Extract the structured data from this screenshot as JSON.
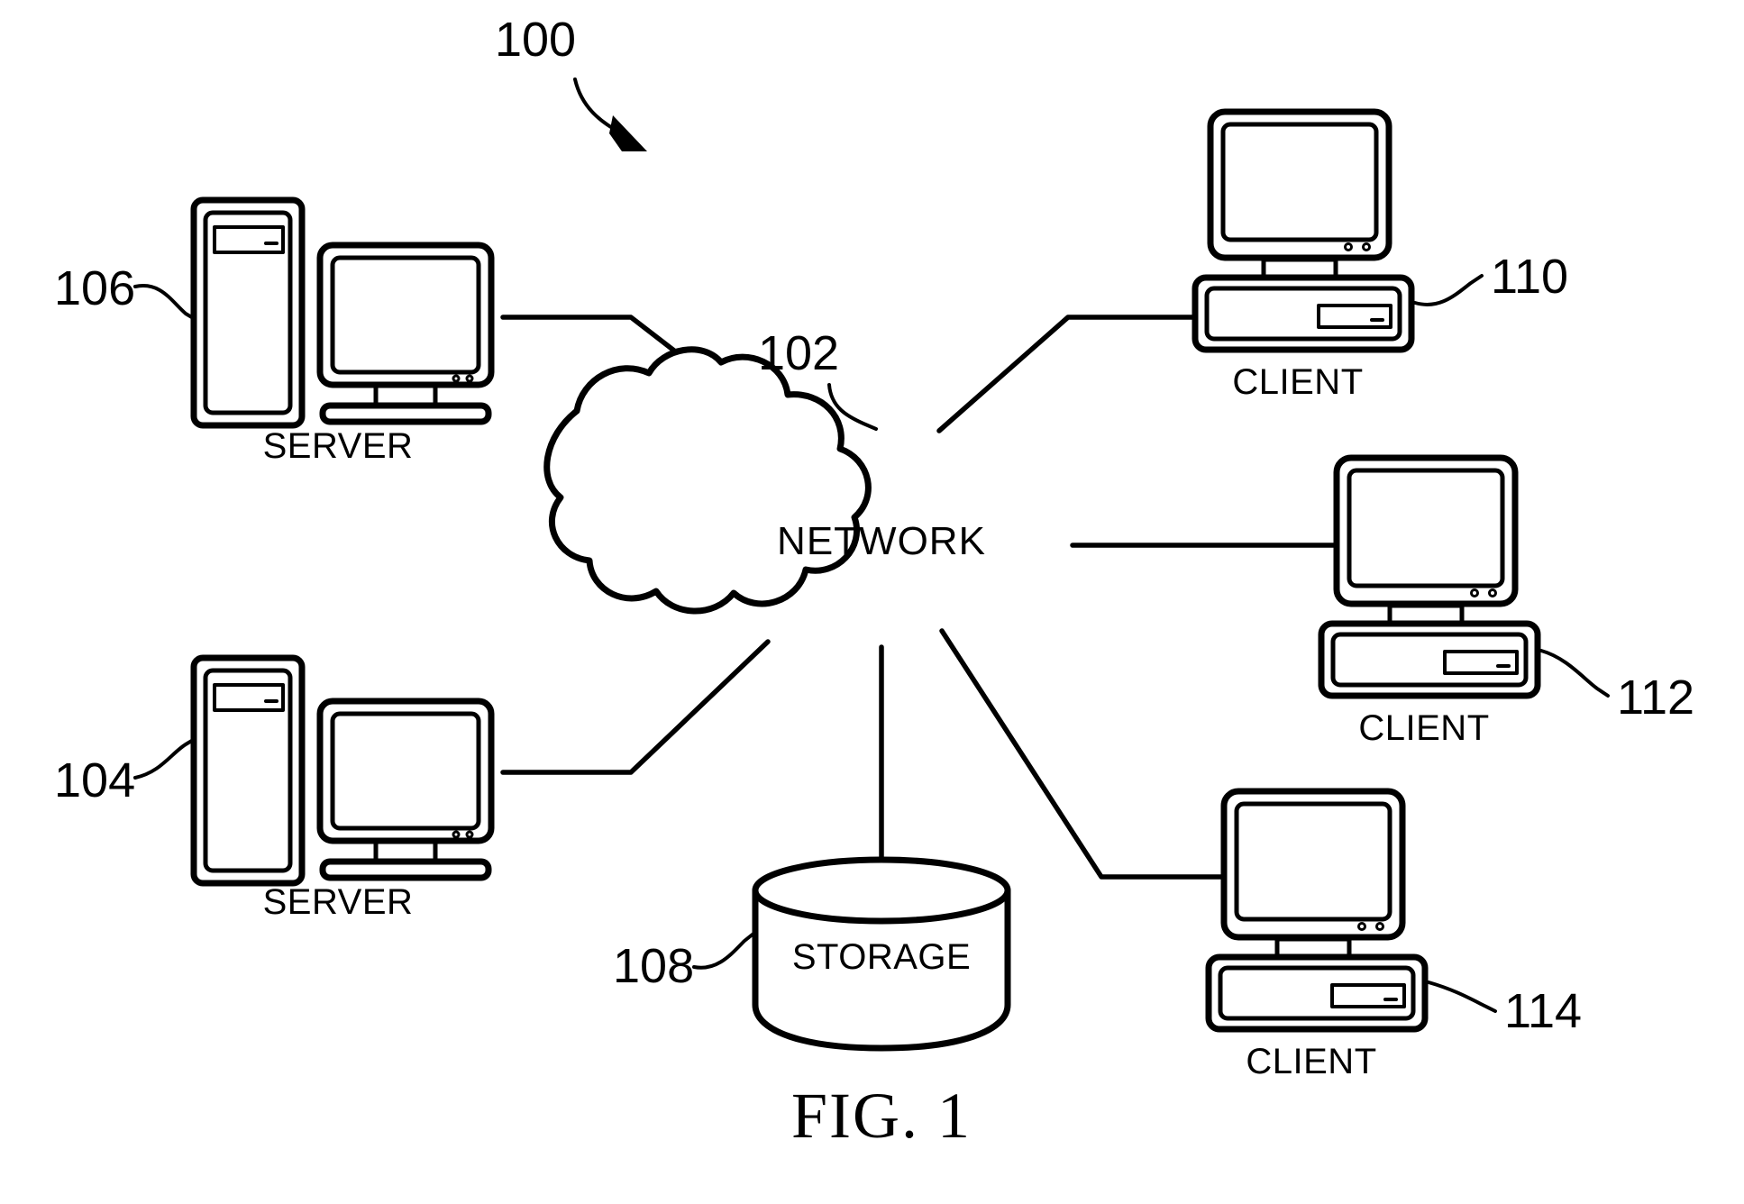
{
  "figure": {
    "caption": "FIG. 1",
    "system_ref": "100"
  },
  "nodes": {
    "network": {
      "label": "NETWORK",
      "ref": "102",
      "shape": "cloud"
    },
    "storage": {
      "label": "STORAGE",
      "ref": "108",
      "shape": "cylinder"
    },
    "server_top": {
      "label": "SERVER",
      "ref": "106",
      "shape": "tower-and-monitor"
    },
    "server_bottom": {
      "label": "SERVER",
      "ref": "104",
      "shape": "tower-and-monitor"
    },
    "client_top": {
      "label": "CLIENT",
      "ref": "110",
      "shape": "desktop-computer"
    },
    "client_middle": {
      "label": "CLIENT",
      "ref": "112",
      "shape": "desktop-computer"
    },
    "client_bottom": {
      "label": "CLIENT",
      "ref": "114",
      "shape": "desktop-computer"
    }
  },
  "connections": [
    {
      "from": "server_top",
      "to": "network"
    },
    {
      "from": "server_bottom",
      "to": "network"
    },
    {
      "from": "network",
      "to": "client_top"
    },
    {
      "from": "network",
      "to": "client_middle"
    },
    {
      "from": "network",
      "to": "client_bottom"
    },
    {
      "from": "network",
      "to": "storage"
    }
  ],
  "colors": {
    "line": "#000000",
    "background": "#ffffff"
  }
}
